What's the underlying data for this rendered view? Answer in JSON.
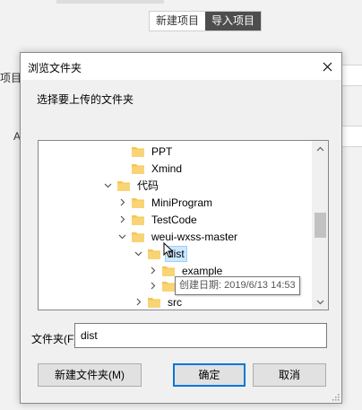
{
  "background": {
    "tabs": [
      {
        "label": "新建项目",
        "active": false
      },
      {
        "label": "导入项目",
        "active": true
      }
    ],
    "label_project": "项目",
    "label_a": "A"
  },
  "dialog": {
    "title": "浏览文件夹",
    "prompt": "选择要上传的文件夹",
    "tree": [
      {
        "label": "PPT",
        "expander": "none",
        "selected": false
      },
      {
        "label": "Xmind",
        "expander": "none",
        "selected": false
      },
      {
        "label": "代码",
        "expander": "expanded",
        "selected": false
      },
      {
        "label": "MiniProgram",
        "expander": "collapsed",
        "selected": false
      },
      {
        "label": "TestCode",
        "expander": "collapsed",
        "selected": false
      },
      {
        "label": "weui-wxss-master",
        "expander": "expanded",
        "selected": false
      },
      {
        "label": "dist",
        "expander": "expanded",
        "selected": true
      },
      {
        "label": "example",
        "expander": "collapsed",
        "selected": false
      },
      {
        "label": "",
        "expander": "collapsed",
        "selected": false
      },
      {
        "label": "src",
        "expander": "collapsed",
        "selected": false
      }
    ],
    "tooltip": "创建日期: 2019/6/13 14:53",
    "folder_label": "文件夹(F):",
    "folder_value": "dist",
    "buttons": {
      "new_folder": "新建文件夹(M)",
      "ok": "确定",
      "cancel": "取消"
    }
  },
  "colors": {
    "folder": "#f7c64b",
    "selection": "#cce8ff",
    "accent": "#0078d7"
  }
}
